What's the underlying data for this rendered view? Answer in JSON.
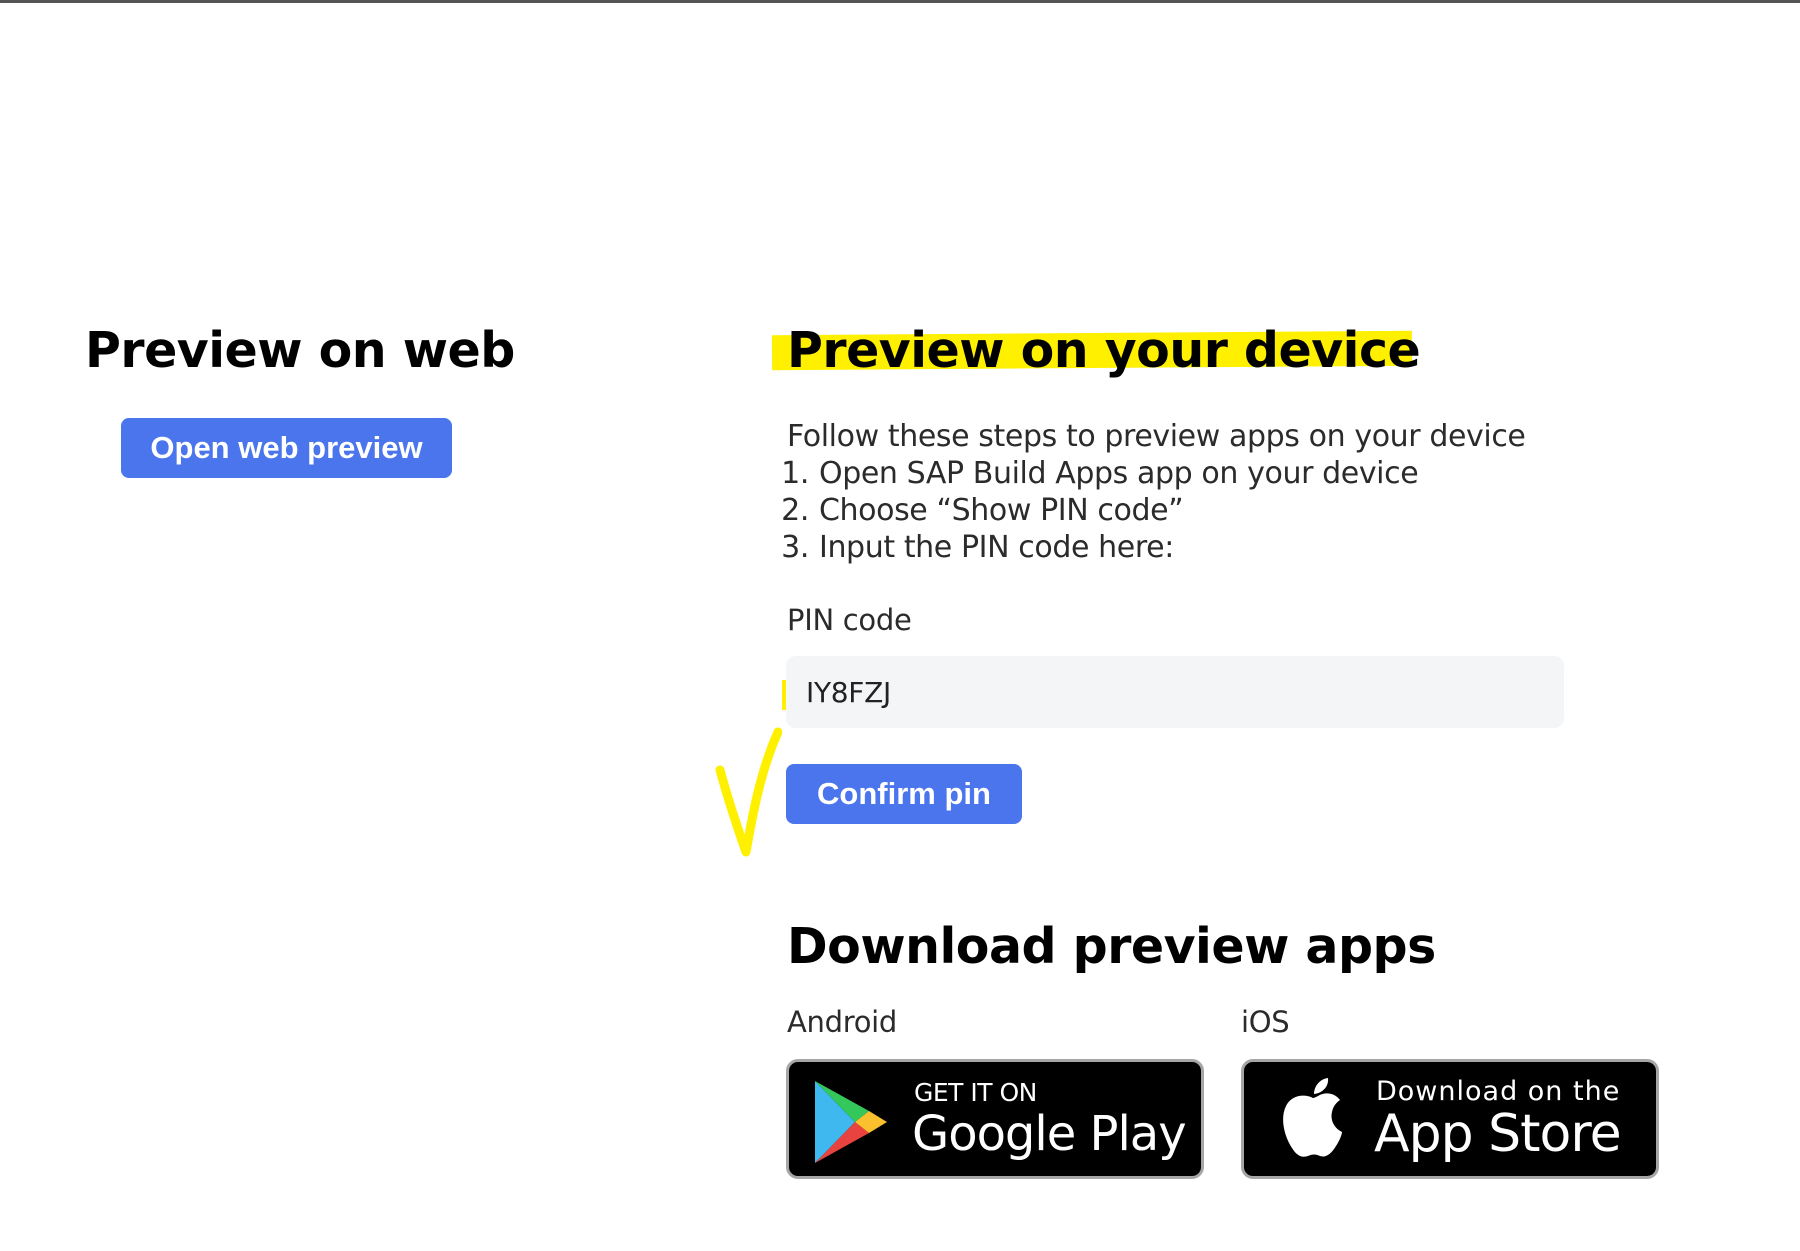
{
  "web_preview": {
    "title": "Preview on web",
    "open_button_label": "Open web preview"
  },
  "device_preview": {
    "title": "Preview on your device",
    "intro": "Follow these steps to preview apps on your device",
    "steps": [
      {
        "num": "1.",
        "text": "Open SAP Build Apps app on your device"
      },
      {
        "num": "2.",
        "text": "Choose “Show PIN code”"
      },
      {
        "num": "3.",
        "text": "Input the PIN code here:"
      }
    ],
    "pin_label": "PIN code",
    "pin_value": "IY8FZJ",
    "confirm_button_label": "Confirm pin"
  },
  "downloads": {
    "title": "Download preview apps",
    "android": {
      "platform_label": "Android",
      "badge_small": "GET IT ON",
      "badge_big": "Google Play",
      "icon": "google-play-icon"
    },
    "ios": {
      "platform_label": "iOS",
      "badge_small": "Download on the",
      "badge_big": "App Store",
      "icon": "apple-icon"
    }
  },
  "colors": {
    "button": "#4a75ec",
    "highlight": "#fff000",
    "input_background": "#f4f5f6"
  }
}
